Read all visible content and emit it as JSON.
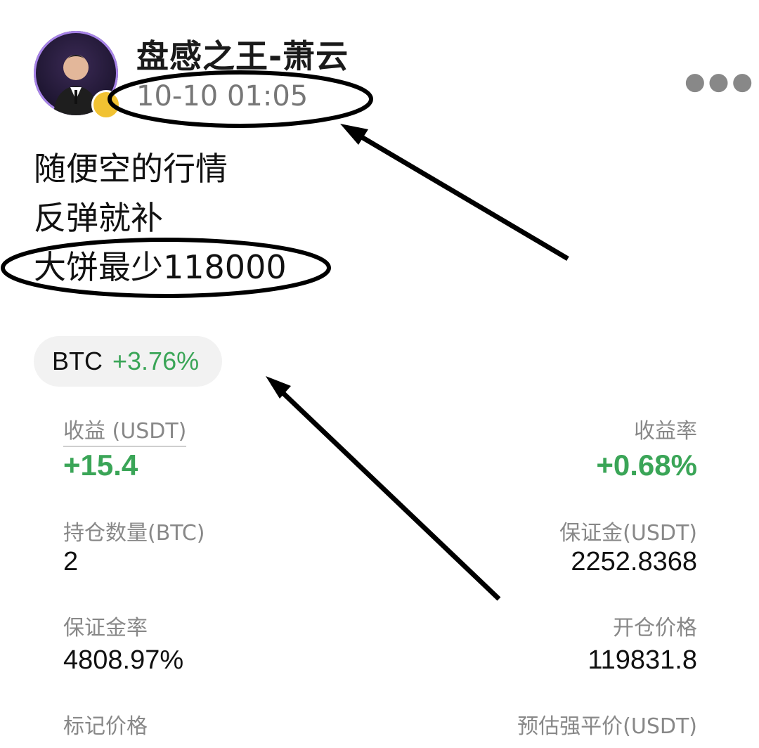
{
  "author": {
    "name": "盘感之王-萧云",
    "time": "10-10 01:05"
  },
  "post": {
    "lines": [
      "随便空的行情",
      "反弹就补",
      "大饼最少118000"
    ]
  },
  "chip": {
    "symbol": "BTC",
    "change": "+3.76%"
  },
  "stats": {
    "pnl_label": "收益 (USDT)",
    "pnl_value": "+15.4",
    "roi_label": "收益率",
    "roi_value": "+0.68%",
    "qty_label": "持仓数量(BTC)",
    "qty_value": "2",
    "margin_label": "保证金(USDT)",
    "margin_value": "2252.8368",
    "margin_ratio_label": "保证金率",
    "margin_ratio_value": "4808.97%",
    "entry_label": "开仓价格",
    "entry_value": "119831.8",
    "mark_label": "标记价格",
    "liq_label": "预估强平价(USDT)"
  },
  "colors": {
    "positive": "#3aa557",
    "annotation": "#000000"
  },
  "icons": {
    "more": "more-dots-icon",
    "avatar": "avatar-image",
    "badge": "verified-badge-icon"
  }
}
